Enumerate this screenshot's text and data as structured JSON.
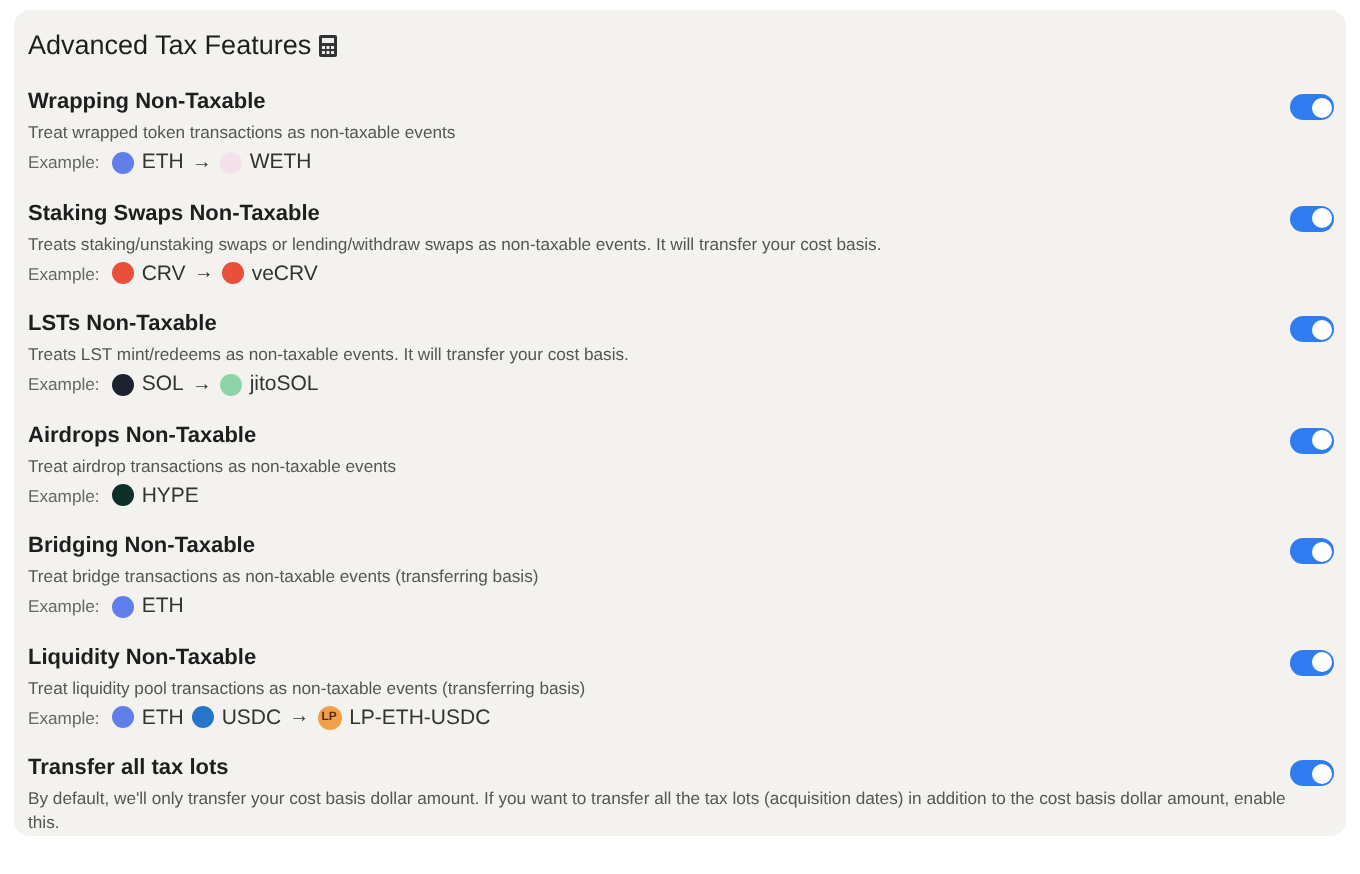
{
  "title": "Advanced Tax Features",
  "settings": [
    {
      "name": "Wrapping Non-Taxable",
      "description": "Treat wrapped token transactions as non-taxable events",
      "example_label": "Example:",
      "example": [
        {
          "kind": "token",
          "symbol": "ETH",
          "color": "#627eea"
        },
        {
          "kind": "arrow",
          "text": "→"
        },
        {
          "kind": "token",
          "symbol": "WETH",
          "color": "#f5e1ec"
        }
      ],
      "on": true
    },
    {
      "name": "Staking Swaps Non-Taxable",
      "description": "Treats staking/unstaking swaps or lending/withdraw swaps as non-taxable events. It will transfer your cost basis.",
      "example_label": "Example:",
      "example": [
        {
          "kind": "token",
          "symbol": "CRV",
          "color": "#e94f3a"
        },
        {
          "kind": "arrow",
          "text": "→"
        },
        {
          "kind": "token",
          "symbol": "veCRV",
          "color": "#e94f3a"
        }
      ],
      "on": true
    },
    {
      "name": "LSTs Non-Taxable",
      "description": "Treats LST mint/redeems as non-taxable events. It will transfer your cost basis.",
      "example_label": "Example:",
      "example": [
        {
          "kind": "token",
          "symbol": "SOL",
          "color": "#1c2230"
        },
        {
          "kind": "arrow",
          "text": "→"
        },
        {
          "kind": "token",
          "symbol": "jitoSOL",
          "color": "#8fd3a8"
        }
      ],
      "on": true
    },
    {
      "name": "Airdrops Non-Taxable",
      "description": "Treat airdrop transactions as non-taxable events",
      "example_label": "Example:",
      "example": [
        {
          "kind": "token",
          "symbol": "HYPE",
          "color": "#0f2f2a"
        }
      ],
      "on": true
    },
    {
      "name": "Bridging Non-Taxable",
      "description": "Treat bridge transactions as non-taxable events (transferring basis)",
      "example_label": "Example:",
      "example": [
        {
          "kind": "token",
          "symbol": "ETH",
          "color": "#627eea"
        }
      ],
      "on": true
    },
    {
      "name": "Liquidity Non-Taxable",
      "description": "Treat liquidity pool transactions as non-taxable events (transferring basis)",
      "example_label": "Example:",
      "example": [
        {
          "kind": "token",
          "symbol": "ETH",
          "color": "#627eea"
        },
        {
          "kind": "token",
          "symbol": "USDC",
          "color": "#2775ca"
        },
        {
          "kind": "arrow",
          "text": "→"
        },
        {
          "kind": "lp",
          "badge": "LP",
          "symbol": "LP-ETH-USDC",
          "color": "#f0a04b"
        }
      ],
      "on": true
    },
    {
      "name": "Transfer all tax lots",
      "description": "By default, we'll only transfer your cost basis dollar amount. If you want to transfer all the tax lots (acquisition dates) in addition to the cost basis dollar amount, enable this.",
      "on": true
    }
  ]
}
